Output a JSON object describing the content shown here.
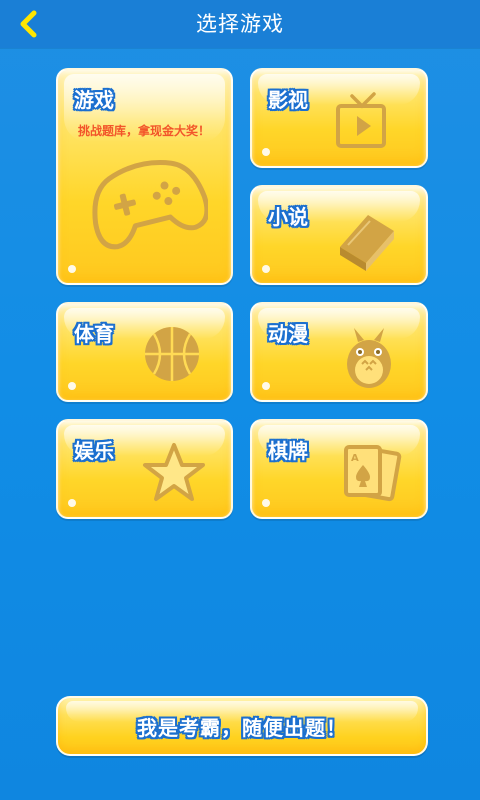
{
  "header": {
    "title": "选择游戏",
    "back_icon": "chevron-left-icon"
  },
  "categories": [
    {
      "label": "游戏",
      "subtitle": "挑战题库，拿现金大奖！",
      "icon": "gamepad-icon"
    },
    {
      "label": "影视",
      "icon": "tv-play-icon"
    },
    {
      "label": "小说",
      "icon": "book-icon"
    },
    {
      "label": "体育",
      "icon": "basketball-icon"
    },
    {
      "label": "动漫",
      "icon": "totoro-icon"
    },
    {
      "label": "娱乐",
      "icon": "star-icon"
    },
    {
      "label": "棋牌",
      "icon": "playing-cards-icon"
    }
  ],
  "cta": {
    "label": "我是考霸，随便出题！"
  },
  "colors": {
    "background": "#118de6",
    "header": "#1a7fd6",
    "card_yellow": "#ffd629",
    "label_outline": "#1b6fcf",
    "subtitle": "#f2552a",
    "icon_tint": "#d2a445"
  }
}
